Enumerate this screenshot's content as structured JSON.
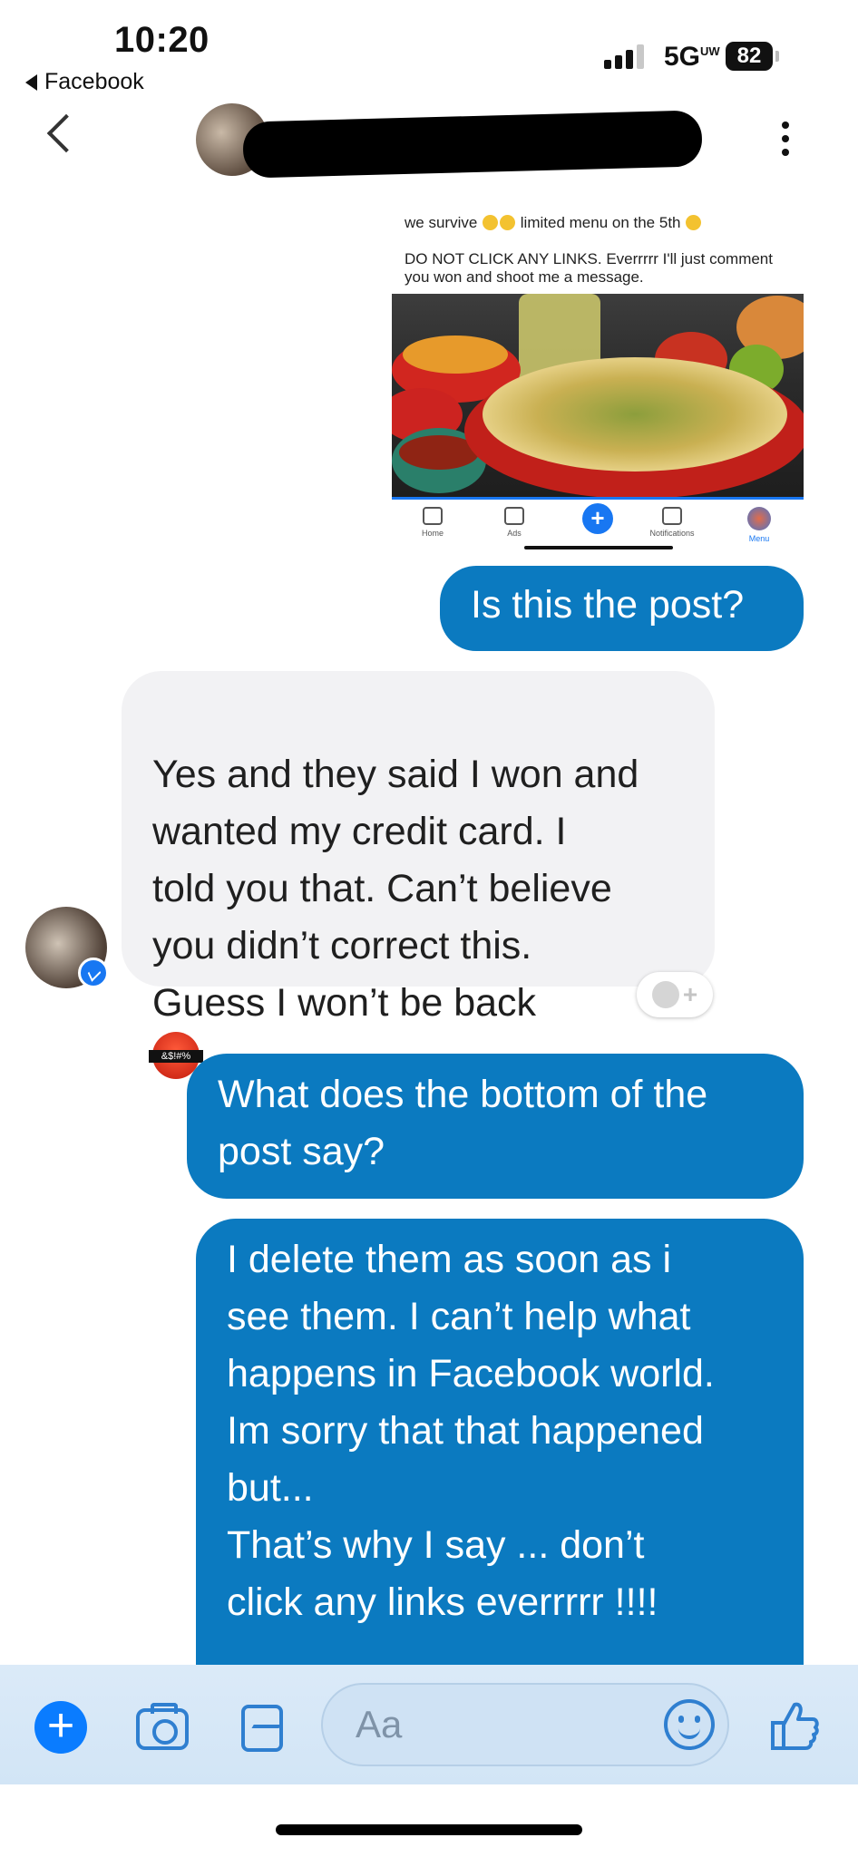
{
  "status_bar": {
    "time": "10:20",
    "back_app": "Facebook",
    "network": "5G",
    "network_super": "UW",
    "battery": "82"
  },
  "shared_post": {
    "line1": "we survive",
    "line1b": "limited menu on the 5th",
    "line2": "DO NOT CLICK ANY LINKS. Everrrrr I'll just comment you won and shoot me a message.",
    "tabs": [
      {
        "label": "Home",
        "icon": "home-icon"
      },
      {
        "label": "Ads",
        "icon": "megaphone-icon"
      },
      {
        "label": "+",
        "icon": "plus-icon"
      },
      {
        "label": "Notifications",
        "icon": "bell-icon"
      },
      {
        "label": "Menu",
        "icon": "profile-menu-icon"
      }
    ]
  },
  "messages": [
    {
      "from": "me",
      "text": "Is this the post?"
    },
    {
      "from": "them",
      "text": "Yes and they said I won and\nwanted my credit card. I\ntold you that. Can’t believe\nyou didn’t correct this.\nGuess I won’t be back",
      "emoji_label": "&$!#%"
    },
    {
      "from": "me",
      "text": "What does the bottom of the\npost say?"
    },
    {
      "from": "me",
      "text": "I delete them as soon as i\nsee them. I can’t help what\nhappens in Facebook world.\nIm sorry that that happened\nbut...\nThat’s why I say ... don’t\nclick any links everrrrr !!!!"
    }
  ],
  "reaction_button": "+",
  "composer": {
    "placeholder": "Aa"
  },
  "colors": {
    "outgoing_bubble": "#0b7ac0",
    "incoming_bubble": "#f2f2f4",
    "accent": "#0a7cff"
  }
}
